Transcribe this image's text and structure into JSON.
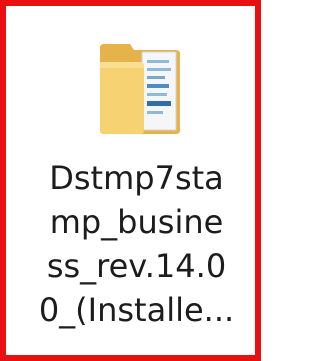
{
  "desktop_item": {
    "icon": "folder-icon",
    "name_lines": [
      "Dstmp7sta",
      "mp_busine",
      "ss_rev.14.0",
      "0_(Installe..."
    ]
  },
  "colors": {
    "selection_border": "#e81010",
    "folder_back": "#e8b84f",
    "folder_front": "#f9d778",
    "text": "#1c1c1c"
  }
}
